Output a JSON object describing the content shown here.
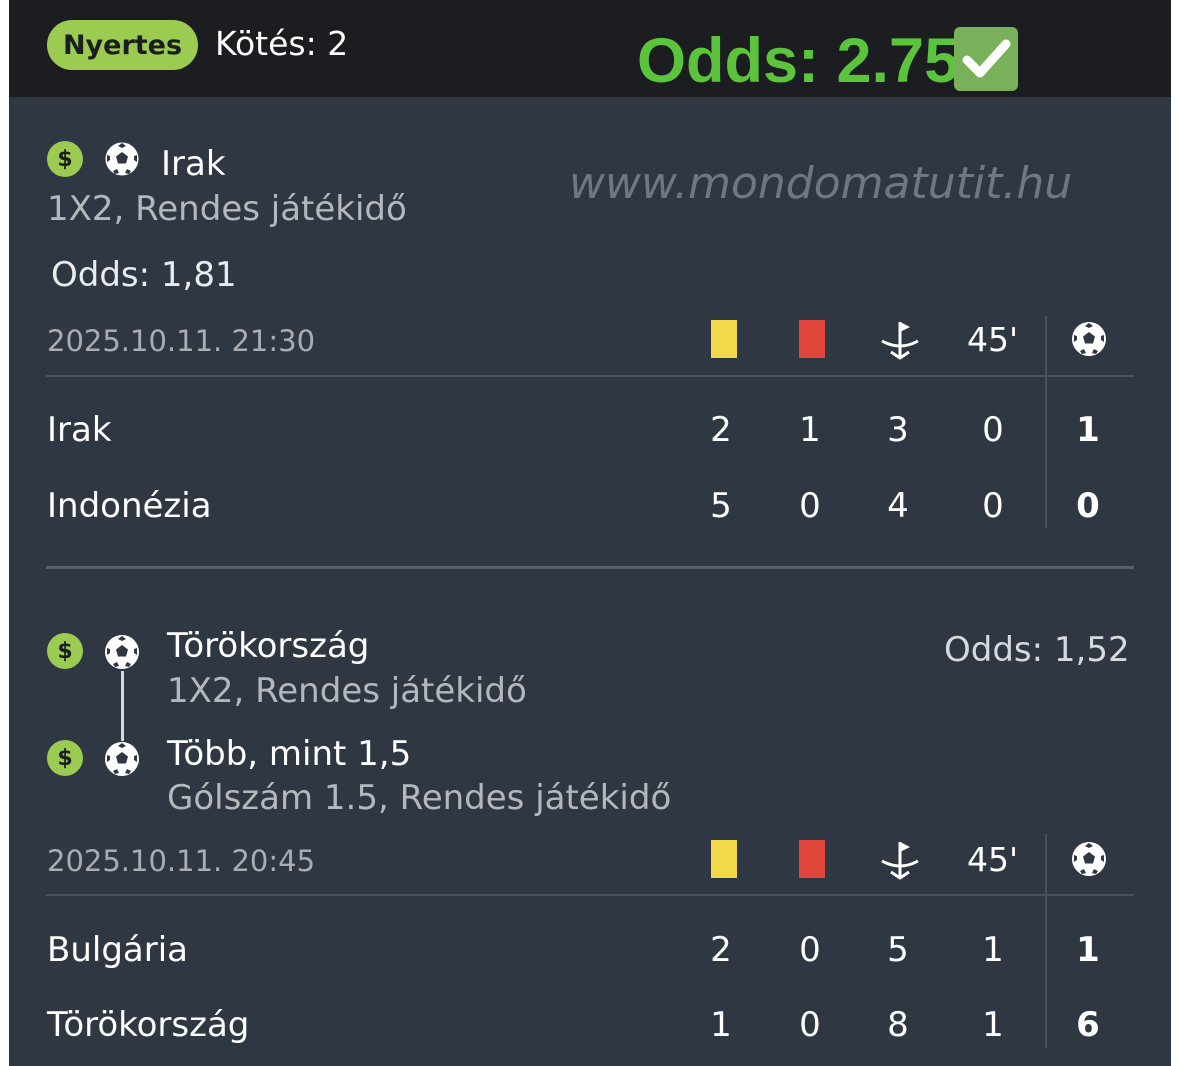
{
  "header": {
    "status_badge": "Nyertes",
    "kotes": "Kötés: 2",
    "total_odds": "Odds: 2.75"
  },
  "watermark": "www.mondomatutit.hu",
  "icons": {
    "dollar": "$",
    "check": "check-icon",
    "ball": "soccer-ball-icon",
    "corner": "corner-flag-icon",
    "yellow": "#f2d94a",
    "red": "#e0453b"
  },
  "colors": {
    "accent_green": "#9bcb50",
    "odds_green": "#5bc33c",
    "card_bg": "#2f3742",
    "topbar_bg": "#1b1d21"
  },
  "columns": {
    "minute": "45'"
  },
  "matches": [
    {
      "selections": [
        {
          "title": "Irak",
          "market": "1X2, Rendes játékidő"
        }
      ],
      "odds": "Odds: 1,81",
      "datetime": "2025.10.11.  21:30",
      "rows": [
        {
          "team": "Irak",
          "yellow": "2",
          "red": "1",
          "corners": "3",
          "half": "0",
          "goals": "1"
        },
        {
          "team": "Indonézia",
          "yellow": "5",
          "red": "0",
          "corners": "4",
          "half": "0",
          "goals": "0"
        }
      ]
    },
    {
      "selections": [
        {
          "title": "Törökország",
          "market": "1X2, Rendes játékidő"
        },
        {
          "title": "Több, mint 1,5",
          "market": "Gólszám 1.5, Rendes játékidő"
        }
      ],
      "odds": "Odds: 1,52",
      "datetime": "2025.10.11.  20:45",
      "rows": [
        {
          "team": "Bulgária",
          "yellow": "2",
          "red": "0",
          "corners": "5",
          "half": "1",
          "goals": "1"
        },
        {
          "team": "Törökország",
          "yellow": "1",
          "red": "0",
          "corners": "8",
          "half": "1",
          "goals": "6"
        }
      ]
    }
  ]
}
